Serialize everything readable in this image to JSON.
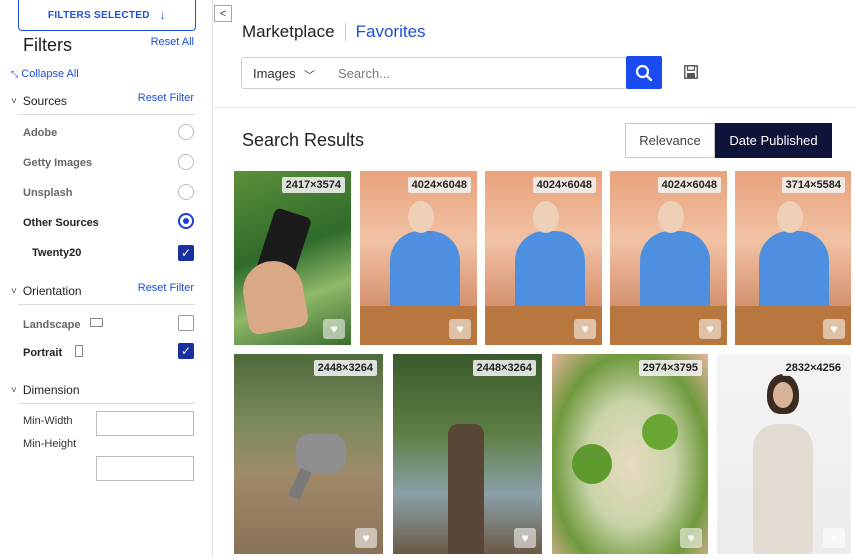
{
  "sidebar": {
    "filters_selected": "FILTERS SELECTED",
    "title": "Filters",
    "reset_all": "Reset All",
    "collapse_all": "Collapse All",
    "sources": {
      "label": "Sources",
      "reset": "Reset Filter",
      "items": [
        {
          "label": "Adobe",
          "selected": false
        },
        {
          "label": "Getty Images",
          "selected": false
        },
        {
          "label": "Unsplash",
          "selected": false
        },
        {
          "label": "Other Sources",
          "selected": true
        }
      ],
      "sub_item": {
        "label": "Twenty20",
        "checked": true
      }
    },
    "orientation": {
      "label": "Orientation",
      "reset": "Reset Filter",
      "items": [
        {
          "label": "Landscape",
          "checked": false
        },
        {
          "label": "Portrait",
          "checked": true
        }
      ]
    },
    "dimension": {
      "label": "Dimension",
      "min_width": "Min-Width",
      "min_height": "Min-Height"
    }
  },
  "header": {
    "tab_marketplace": "Marketplace",
    "tab_favorites": "Favorites",
    "type_select": "Images",
    "search_placeholder": "Search..."
  },
  "results": {
    "title": "Search Results",
    "sort_relevance": "Relevance",
    "sort_date": "Date Published",
    "images": [
      {
        "dims": "2417×3574",
        "scene": "phone"
      },
      {
        "dims": "4024×6048",
        "scene": "woman"
      },
      {
        "dims": "4024×6048",
        "scene": "woman"
      },
      {
        "dims": "4024×6048",
        "scene": "woman"
      },
      {
        "dims": "3714×5584",
        "scene": "woman"
      },
      {
        "dims": "2448×3264",
        "scene": "goat"
      },
      {
        "dims": "2448×3264",
        "scene": "tree"
      },
      {
        "dims": "2974×3795",
        "scene": "food"
      },
      {
        "dims": "2832×4256",
        "scene": "bride"
      }
    ]
  },
  "colors": {
    "accent": "#1d4ed8",
    "search_button": "#1a4bf0",
    "sort_active": "#101339"
  }
}
